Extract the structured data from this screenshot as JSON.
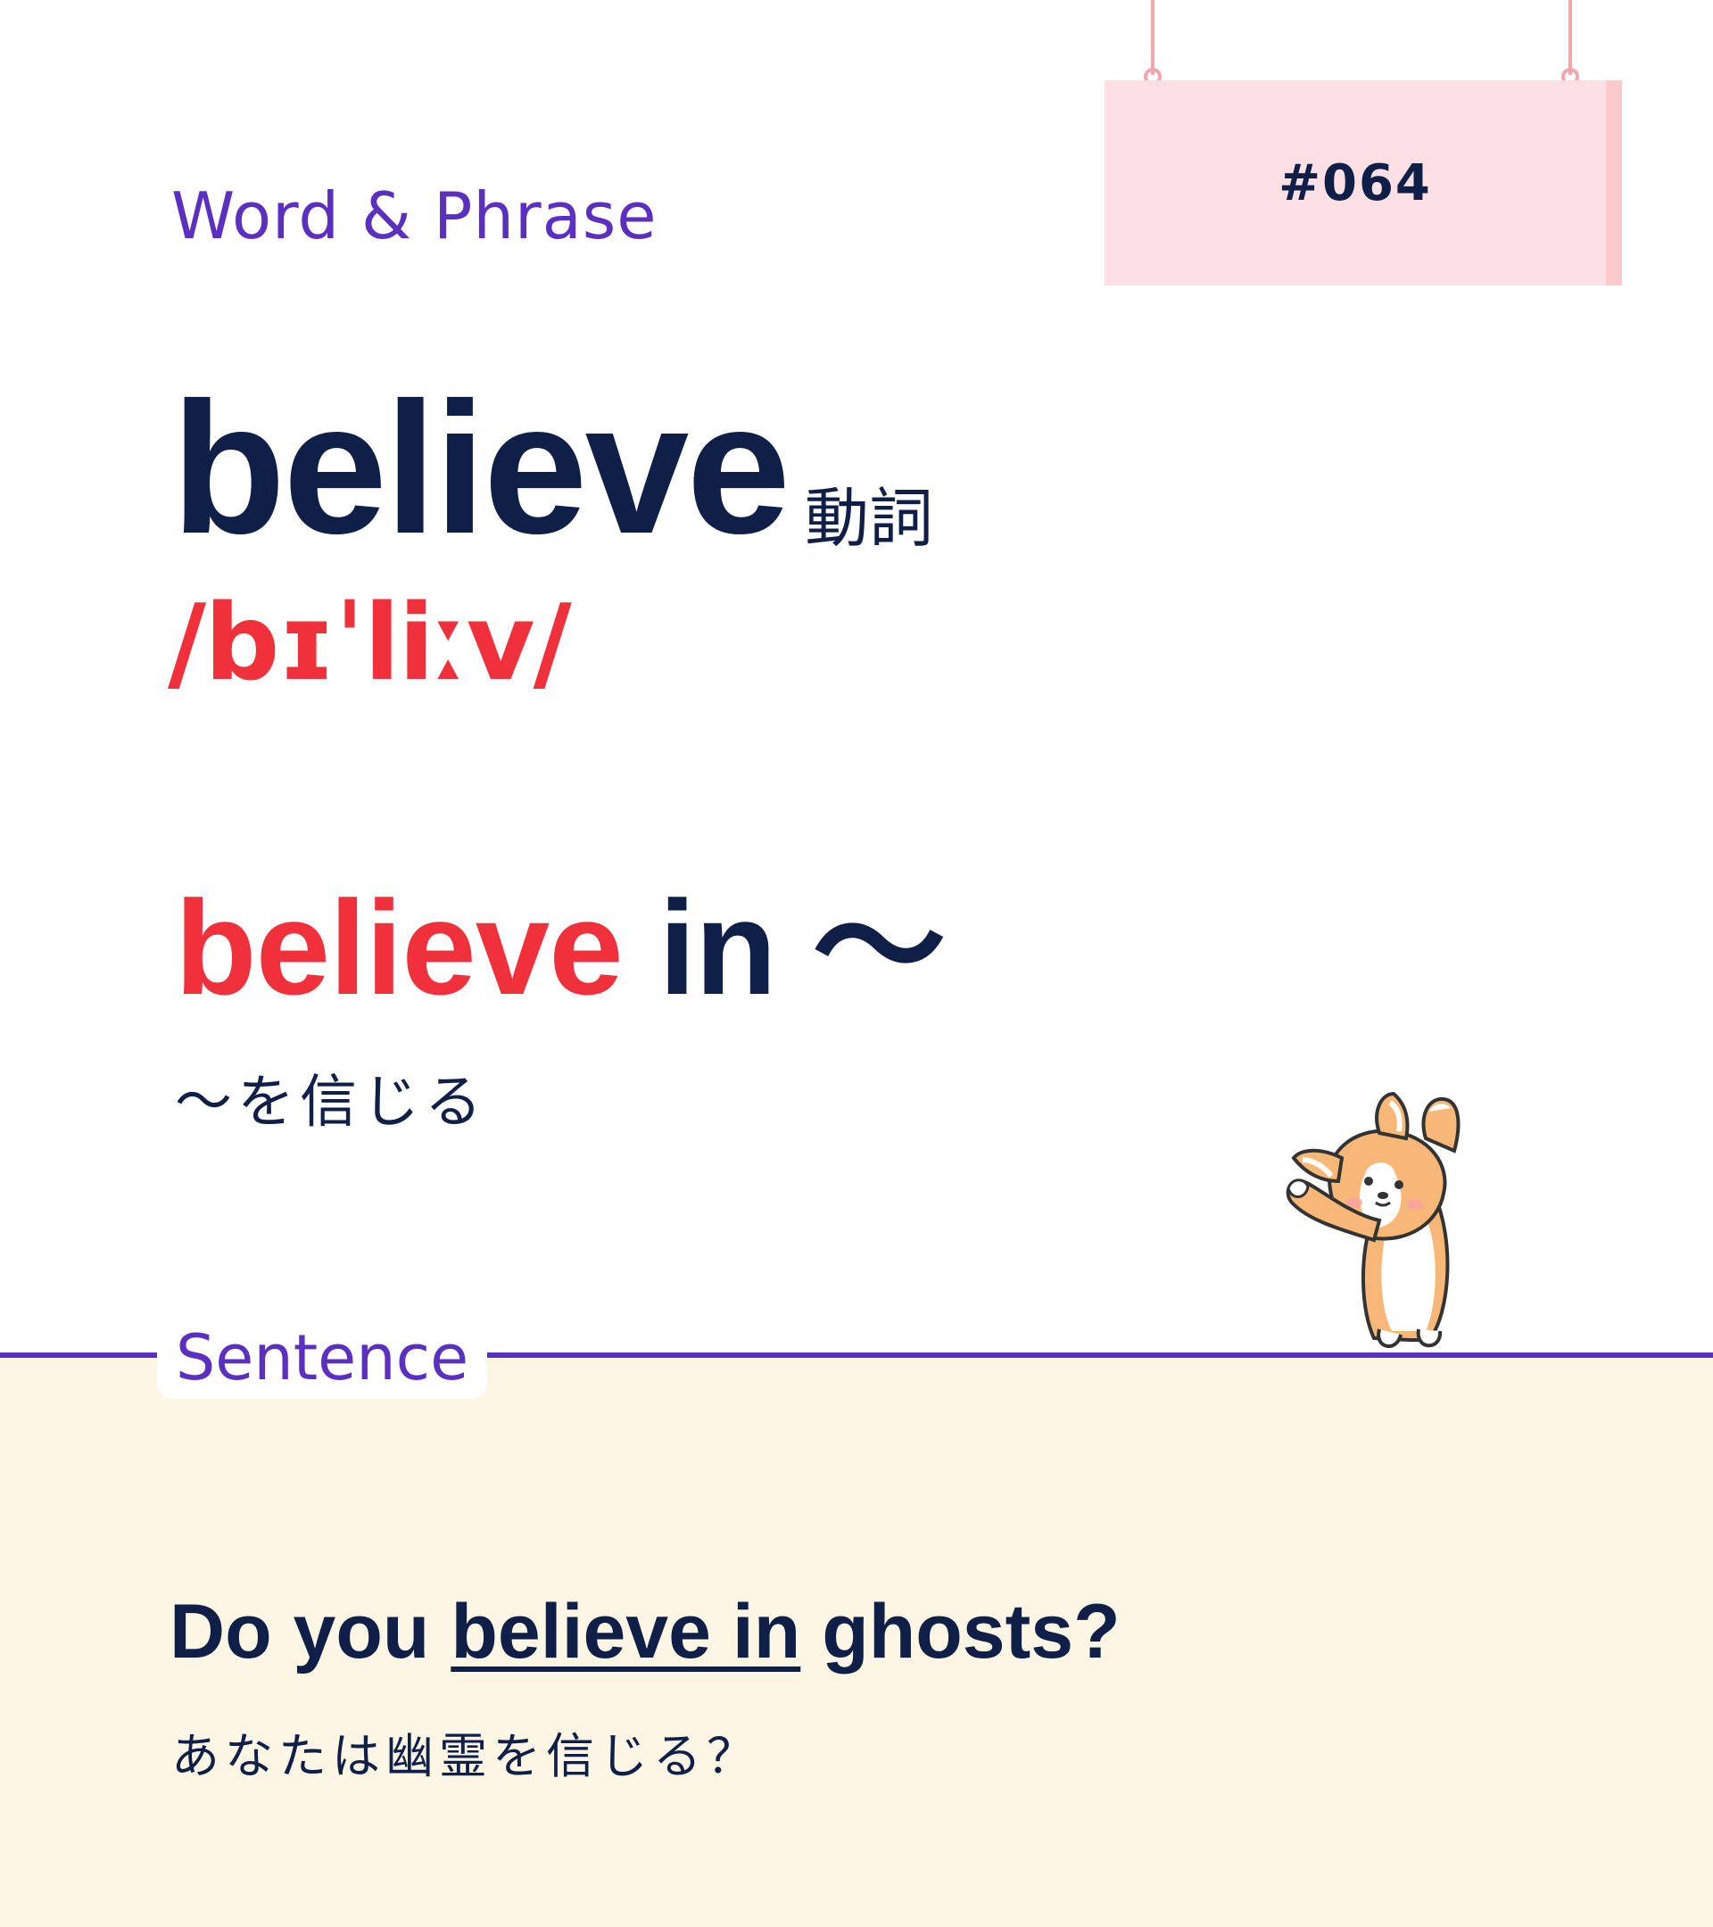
{
  "header": {
    "section_label": "Word & Phrase",
    "entry_number": "#064"
  },
  "word": {
    "headword": "believe",
    "part_of_speech": "動詞",
    "pronunciation": "/bɪˈliːv/"
  },
  "phrase": {
    "highlight": "believe",
    "rest": " in ～",
    "meaning": "～を信じる"
  },
  "sentence_section": {
    "label": "Sentence",
    "example_before": "Do you ",
    "example_underlined": "believe in",
    "example_after": " ghosts?",
    "translation": "あなたは幽霊を信じる？"
  },
  "colors": {
    "navy": "#0f1f47",
    "purple": "#5b30c0",
    "red": "#f0303a",
    "sign_pink": "#fde0e3",
    "cream": "#fdf6e4"
  },
  "illustration": "corgi-mascot"
}
